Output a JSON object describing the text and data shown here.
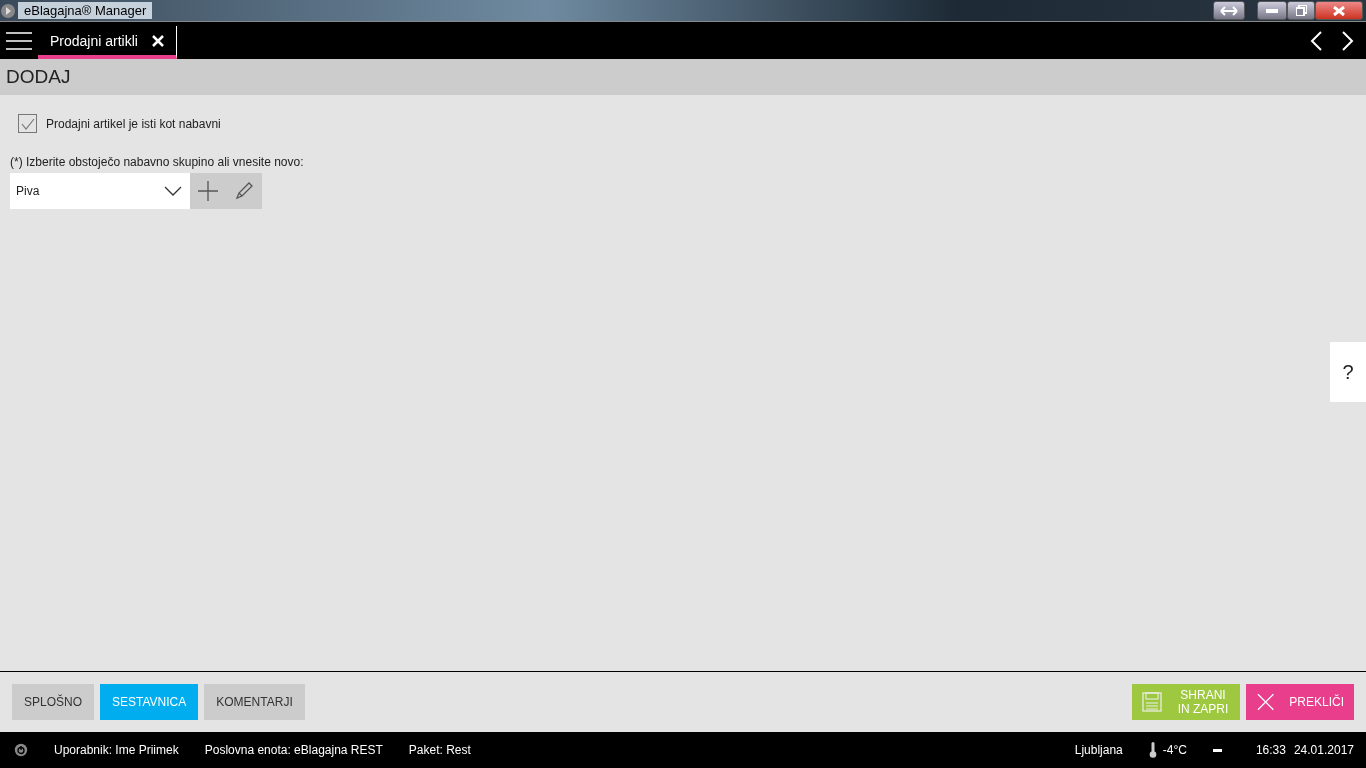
{
  "window": {
    "title": "eBlagajna® Manager"
  },
  "tabs": [
    {
      "label": "Prodajni artikli",
      "selected": true
    }
  ],
  "page_title": "DODAJ",
  "form": {
    "same_checkbox": {
      "label": "Prodajni artikel je isti kot nabavni",
      "checked": true
    },
    "group_label": "(*) Izberite obstoječo nabavno skupino ali vnesite novo:",
    "group_value": "Piva"
  },
  "help": "?",
  "section_tabs": [
    {
      "label": "SPLOŠNO",
      "selected": false
    },
    {
      "label": "SESTAVNICA",
      "selected": true
    },
    {
      "label": "KOMENTARJI",
      "selected": false
    }
  ],
  "actions": [
    {
      "kind": "save",
      "label": "SHRANI IN ZAPRI"
    },
    {
      "kind": "cancel",
      "label": "PREKLIČI"
    }
  ],
  "status_bar": {
    "user": "Uporabnik: Ime Priimek",
    "unit": "Poslovna enota: eBlagajna REST",
    "package": "Paket: Rest",
    "city": "Ljubljana",
    "temperature": "-4°C",
    "time": "16:33",
    "date": "24.01.2017"
  }
}
